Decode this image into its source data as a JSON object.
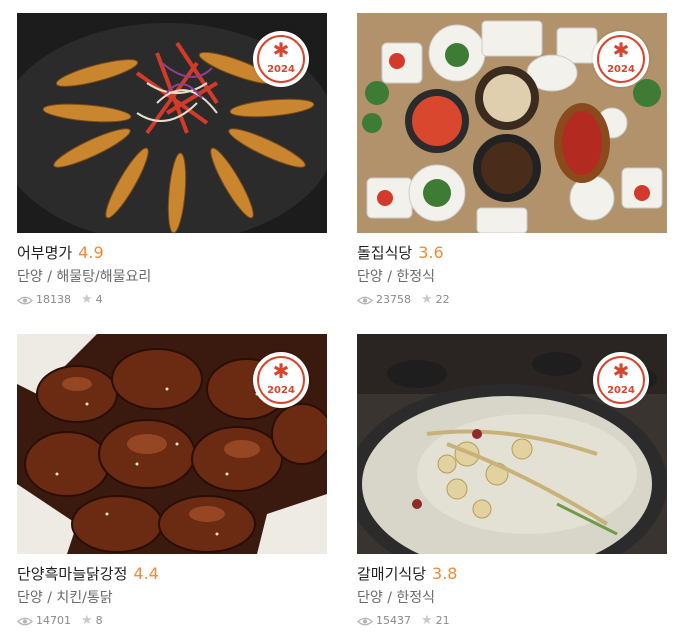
{
  "restaurants": [
    {
      "name": "어부명가",
      "rating": "4.9",
      "category": "단양 / 해물탕/해물요리",
      "views": "18138",
      "reviews": "4",
      "badge_year": "2024",
      "photo_icon": "food-photo"
    },
    {
      "name": "돌집식당",
      "rating": "3.6",
      "category": "단양 / 한정식",
      "views": "23758",
      "reviews": "22",
      "badge_year": "2024",
      "photo_icon": "food-photo"
    },
    {
      "name": "단양흑마늘닭강정",
      "rating": "4.4",
      "category": "단양 / 치킨/통닭",
      "views": "14701",
      "reviews": "8",
      "badge_year": "2024",
      "photo_icon": "food-photo"
    },
    {
      "name": "갈매기식당",
      "rating": "3.8",
      "category": "단양 / 한정식",
      "views": "15437",
      "reviews": "21",
      "badge_year": "2024",
      "photo_icon": "food-photo"
    }
  ],
  "badge": {
    "symbol": "✱",
    "color": "#d8452e"
  },
  "icons": {
    "views": "eye-icon",
    "reviews": "star-icon"
  },
  "colors": {
    "rating": "#f08a3a",
    "category": "#6b6b6b",
    "stats": "#8a8a8a"
  }
}
